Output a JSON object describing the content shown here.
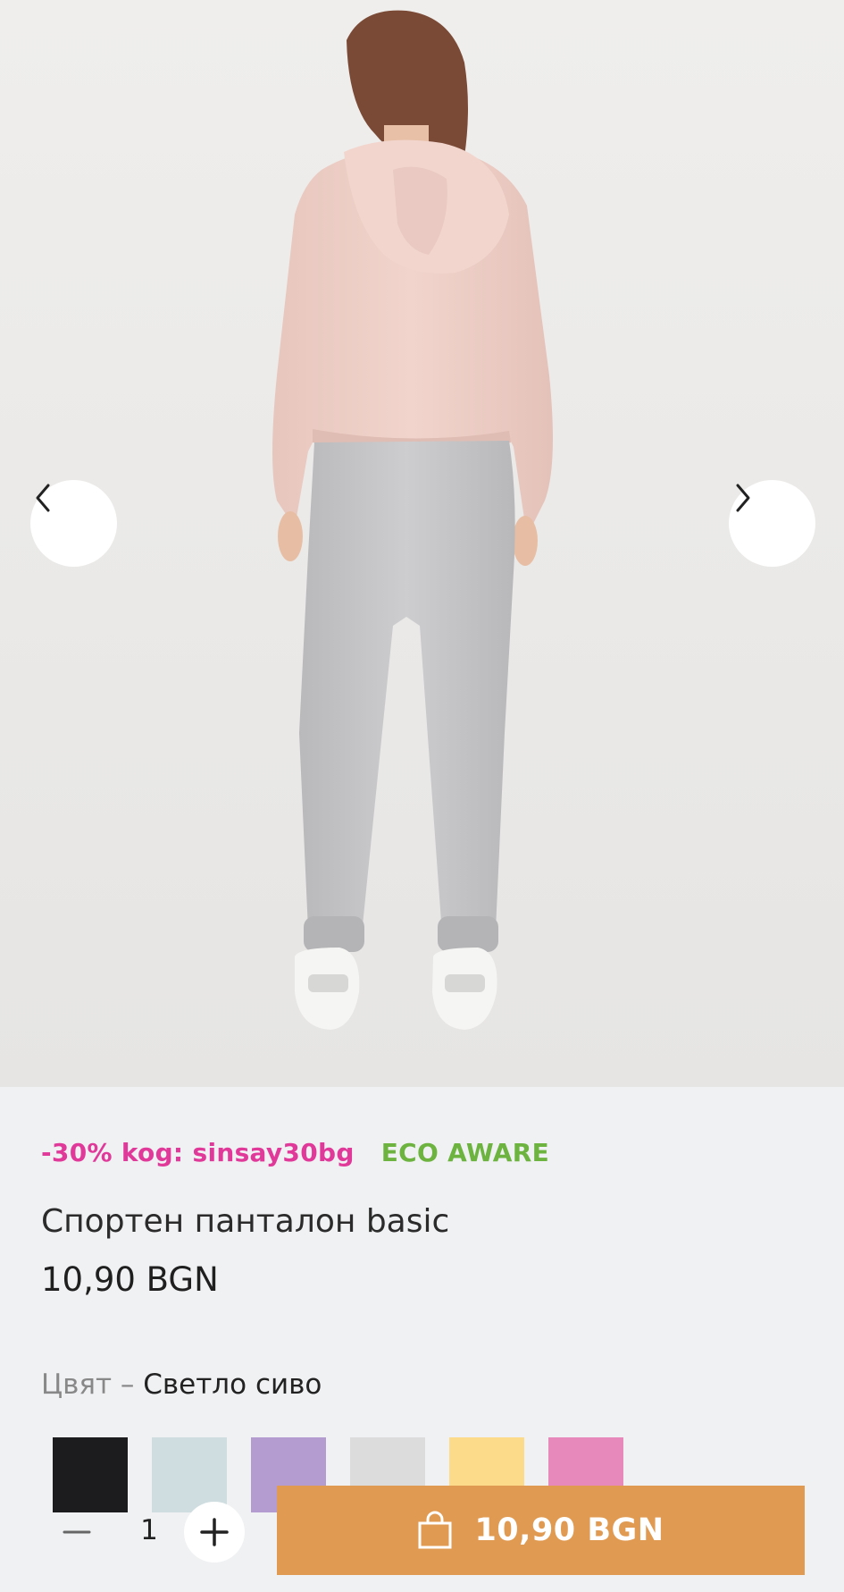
{
  "product": {
    "promo_label": "-30% kog: sinsay30bg",
    "eco_label": "ECO AWARE",
    "title": "Спортен панталон basic",
    "price": "10,90 BGN"
  },
  "color": {
    "label": "Цвят – ",
    "selected": "Светло сиво",
    "swatches": [
      {
        "name": "black",
        "hex": "#1c1c1f"
      },
      {
        "name": "light-blue",
        "hex": "#cfdde0"
      },
      {
        "name": "lilac",
        "hex": "#b49bd0"
      },
      {
        "name": "light-gray",
        "hex": "#dcdcdc"
      },
      {
        "name": "yellow",
        "hex": "#fcdc8a"
      },
      {
        "name": "pink",
        "hex": "#e889bb"
      }
    ]
  },
  "cart": {
    "quantity": "1",
    "button_price": "10,90 BGN"
  },
  "colors": {
    "accent": "#e09a52",
    "promo": "#e0399a",
    "eco": "#6cb33f"
  },
  "icons": {
    "prev": "chevron-left-icon",
    "next": "chevron-right-icon",
    "minus": "minus-icon",
    "plus": "plus-icon",
    "bag": "shopping-bag-icon"
  }
}
